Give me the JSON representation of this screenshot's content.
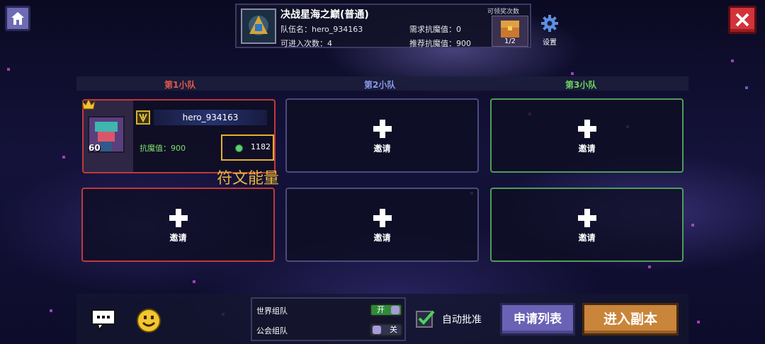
{
  "dungeon": {
    "title": "决战星海之巅(普通)",
    "team_name_label": "队伍名：",
    "team_name": "hero_934163",
    "entries_label": "可进入次数：",
    "entries": "4",
    "required_resist_label": "需求抗魔值：",
    "required_resist": "0",
    "recommended_resist_label": "推荐抗魔值：",
    "recommended_resist": "900",
    "reward_label": "可领奖次数",
    "reward_count": "1/2"
  },
  "settings_label": "设置",
  "teams": [
    {
      "label": "第1小队",
      "color": "#e25a4e"
    },
    {
      "label": "第2小队",
      "color": "#8a9ae8"
    },
    {
      "label": "第3小队",
      "color": "#6fd35f"
    }
  ],
  "member": {
    "name": "hero_934163",
    "level": "60",
    "resist_label": "抗魔值：",
    "resist": "900",
    "rune_energy": "1182"
  },
  "rune_energy_label": "符文能量",
  "invite_label": "邀请",
  "toggles": [
    {
      "label": "世界组队",
      "state": "开",
      "on": true
    },
    {
      "label": "公会组队",
      "state": "关",
      "on": false
    }
  ],
  "auto_approve_label": "自动批准",
  "apply_list_label": "申请列表",
  "enter_label": "进入副本"
}
